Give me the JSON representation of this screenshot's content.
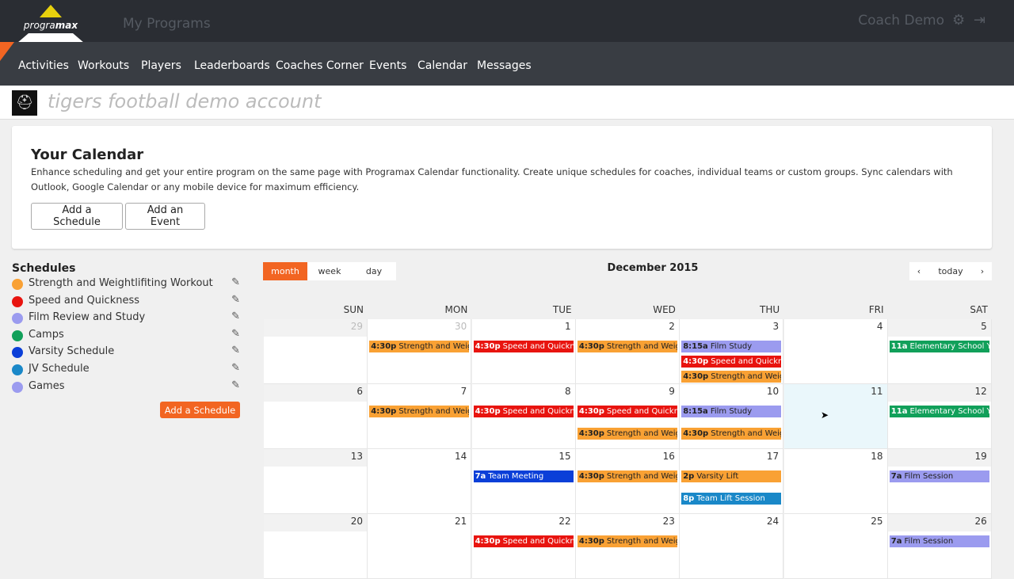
{
  "brand": {
    "logo_text": "programax",
    "my_programs": "My Programs",
    "user": "Coach Demo"
  },
  "nav": [
    "Activities",
    "Workouts",
    "Players",
    "Leaderboards",
    "Coaches Corner",
    "Events",
    "Calendar",
    "Messages"
  ],
  "account": "tigers football demo account",
  "intro": {
    "title": "Your Calendar",
    "text": "Enhance scheduling and get your entire program on the same page with Programax Calendar functionality. Create unique schedules for coaches, individual teams or custom groups. Sync calendars with Outlook, Google Calendar or any mobile device for maximum efficiency.",
    "add_schedule": "Add a Schedule",
    "add_event": "Add an Event"
  },
  "schedules": {
    "title": "Schedules",
    "add": "Add a Schedule",
    "items": [
      {
        "label": "Strength and Weightlifiting Workout",
        "color": "#f9a134"
      },
      {
        "label": "Speed and Quickness",
        "color": "#e8140f"
      },
      {
        "label": "Film Review and Study",
        "color": "#9b9bef"
      },
      {
        "label": "Camps",
        "color": "#11a05a"
      },
      {
        "label": "Varsity Schedule",
        "color": "#0b3fd8"
      },
      {
        "label": "JV Schedule",
        "color": "#1a88c8"
      },
      {
        "label": "Games",
        "color": "#9b9bef"
      }
    ]
  },
  "calendar": {
    "views": [
      "month",
      "week",
      "day"
    ],
    "title": "December 2015",
    "today": "today",
    "prev": "‹",
    "next": "›",
    "dow": [
      "SUN",
      "MON",
      "TUE",
      "WED",
      "THU",
      "FRI",
      "SAT"
    ],
    "weeks": [
      [
        {
          "n": "29",
          "o": true,
          "e": []
        },
        {
          "n": "30",
          "o": true,
          "e": [
            {
              "t": "4:30p",
              "l": "Strength and Weightlifiting Workout",
              "c": "o",
              "s": 0
            }
          ]
        },
        {
          "n": "1",
          "e": [
            {
              "t": "4:30p",
              "l": "Speed and Quickness",
              "c": "r",
              "s": 0
            }
          ]
        },
        {
          "n": "2",
          "e": [
            {
              "t": "4:30p",
              "l": "Strength and Weightlifiting Workout",
              "c": "o",
              "s": 0
            }
          ]
        },
        {
          "n": "3",
          "e": [
            {
              "t": "8:15a",
              "l": "Film Study",
              "c": "f",
              "s": 0
            },
            {
              "t": "4:30p",
              "l": "Speed and Quickness",
              "c": "r",
              "s": 1
            },
            {
              "t": "4:30p",
              "l": "Strength and Weightlifiting Workout",
              "c": "o",
              "s": 2
            }
          ]
        },
        {
          "n": "4",
          "e": []
        },
        {
          "n": "5",
          "e": [
            {
              "t": "11a",
              "l": "Elementary School Youth Camp",
              "c": "g",
              "s": 0
            }
          ]
        }
      ],
      [
        {
          "n": "6",
          "e": []
        },
        {
          "n": "7",
          "e": [
            {
              "t": "4:30p",
              "l": "Strength and Weightlifiting Workout",
              "c": "o",
              "s": 0
            }
          ]
        },
        {
          "n": "8",
          "e": [
            {
              "t": "4:30p",
              "l": "Speed and Quickness",
              "c": "r",
              "s": 0
            }
          ]
        },
        {
          "n": "9",
          "e": [
            {
              "t": "4:30p",
              "l": "Speed and Quickness",
              "c": "r",
              "s": 0
            },
            {
              "t": "4:30p",
              "l": "Strength and Weightlifiting Workout",
              "c": "o",
              "s": 1
            }
          ]
        },
        {
          "n": "10",
          "e": [
            {
              "t": "8:15a",
              "l": "Film Study",
              "c": "f",
              "s": 0
            },
            {
              "t": "4:30p",
              "l": "Strength and Weightlifiting Workout",
              "c": "o",
              "s": 1
            }
          ]
        },
        {
          "n": "11",
          "today": true,
          "e": []
        },
        {
          "n": "12",
          "e": [
            {
              "t": "11a",
              "l": "Elementary School Youth Camp",
              "c": "g",
              "s": 0
            }
          ]
        }
      ],
      [
        {
          "n": "13",
          "e": []
        },
        {
          "n": "14",
          "e": []
        },
        {
          "n": "15",
          "e": [
            {
              "t": "7a",
              "l": "Team Meeting",
              "c": "v",
              "s": 0
            }
          ]
        },
        {
          "n": "16",
          "e": [
            {
              "t": "4:30p",
              "l": "Strength and Weightlifiting Workout",
              "c": "o",
              "s": 0
            }
          ]
        },
        {
          "n": "17",
          "e": [
            {
              "t": "2p",
              "l": "Varsity Lift",
              "c": "o",
              "s": 0
            },
            {
              "t": "8p",
              "l": "Team Lift Session",
              "c": "j",
              "s": 1
            }
          ]
        },
        {
          "n": "18",
          "e": []
        },
        {
          "n": "19",
          "e": [
            {
              "t": "7a",
              "l": "Film Session",
              "c": "f",
              "s": 0
            }
          ]
        }
      ],
      [
        {
          "n": "20",
          "e": []
        },
        {
          "n": "21",
          "e": []
        },
        {
          "n": "22",
          "e": [
            {
              "t": "4:30p",
              "l": "Speed and Quickness",
              "c": "r",
              "s": 0
            }
          ]
        },
        {
          "n": "23",
          "e": [
            {
              "t": "4:30p",
              "l": "Strength and Weightlifiting Workout",
              "c": "o",
              "s": 0
            }
          ]
        },
        {
          "n": "24",
          "e": []
        },
        {
          "n": "25",
          "e": []
        },
        {
          "n": "26",
          "e": [
            {
              "t": "7a",
              "l": "Film Session",
              "c": "f",
              "s": 0
            }
          ]
        }
      ]
    ]
  },
  "colors": {
    "o": "#f9a134",
    "r": "#e8140f",
    "f": "#9b9bef",
    "g": "#11a05a",
    "v": "#0b3fd8",
    "j": "#1a88c8",
    "accent": "#f26522"
  }
}
